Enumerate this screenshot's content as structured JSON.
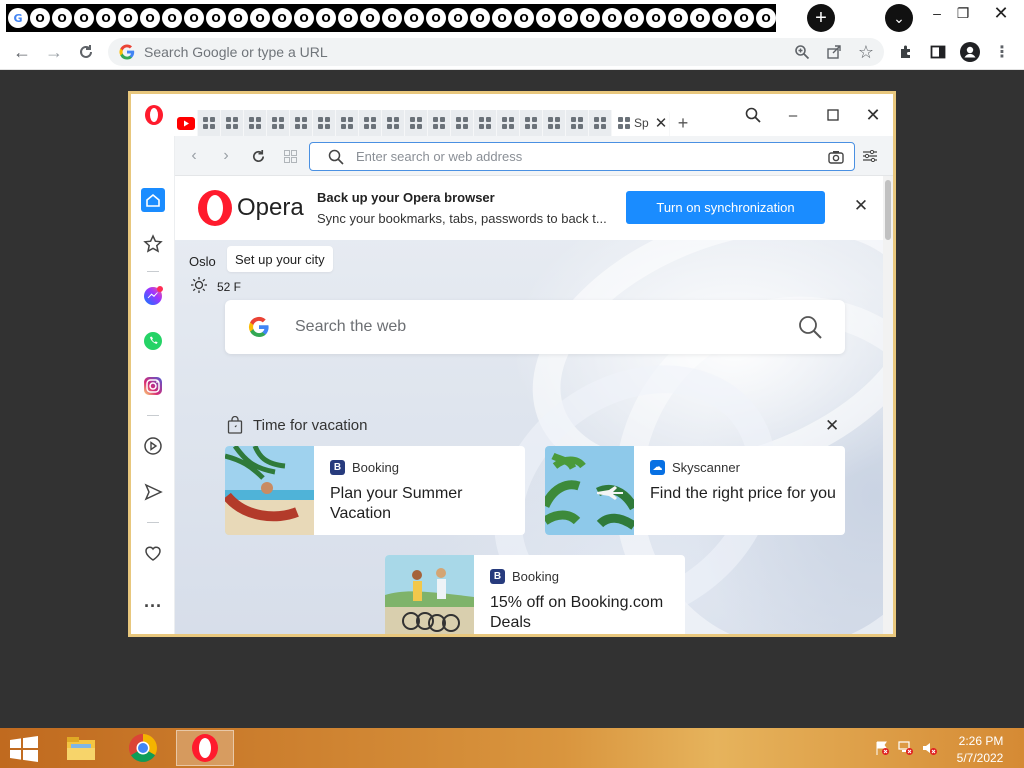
{
  "chrome": {
    "tab_count": 38,
    "omnibox_placeholder": "Search Google or type a URL"
  },
  "opera": {
    "active_tab_title": "Sp",
    "address_placeholder": "Enter search or web address",
    "sync_banner": {
      "logo_text": "Opera",
      "title": "Back up your Opera browser",
      "subtitle": "Sync your bookmarks, tabs, passwords to back t...",
      "button_label": "Turn on synchronization"
    },
    "weather": {
      "city": "Oslo",
      "setup_label": "Set up your city",
      "temperature": "52 F"
    },
    "search": {
      "placeholder": "Search the web"
    },
    "vacation": {
      "title": "Time for vacation",
      "cards": [
        {
          "brand": "Booking",
          "badge": "B",
          "badge_color": "#273b7d",
          "title": "Plan your Summer Vacation"
        },
        {
          "brand": "Skyscanner",
          "badge": "☁",
          "badge_color": "#0770e3",
          "title": "Find the right price for you"
        },
        {
          "brand": "Booking",
          "badge": "B",
          "badge_color": "#273b7d",
          "title": "15% off on Booking.com Deals"
        }
      ]
    }
  },
  "taskbar": {
    "time": "2:26 PM",
    "date": "5/7/2022"
  },
  "colors": {
    "sync_button": "#1a8cff",
    "opera_red": "#ff1b2d",
    "frame_gold": "#e8c77d"
  }
}
